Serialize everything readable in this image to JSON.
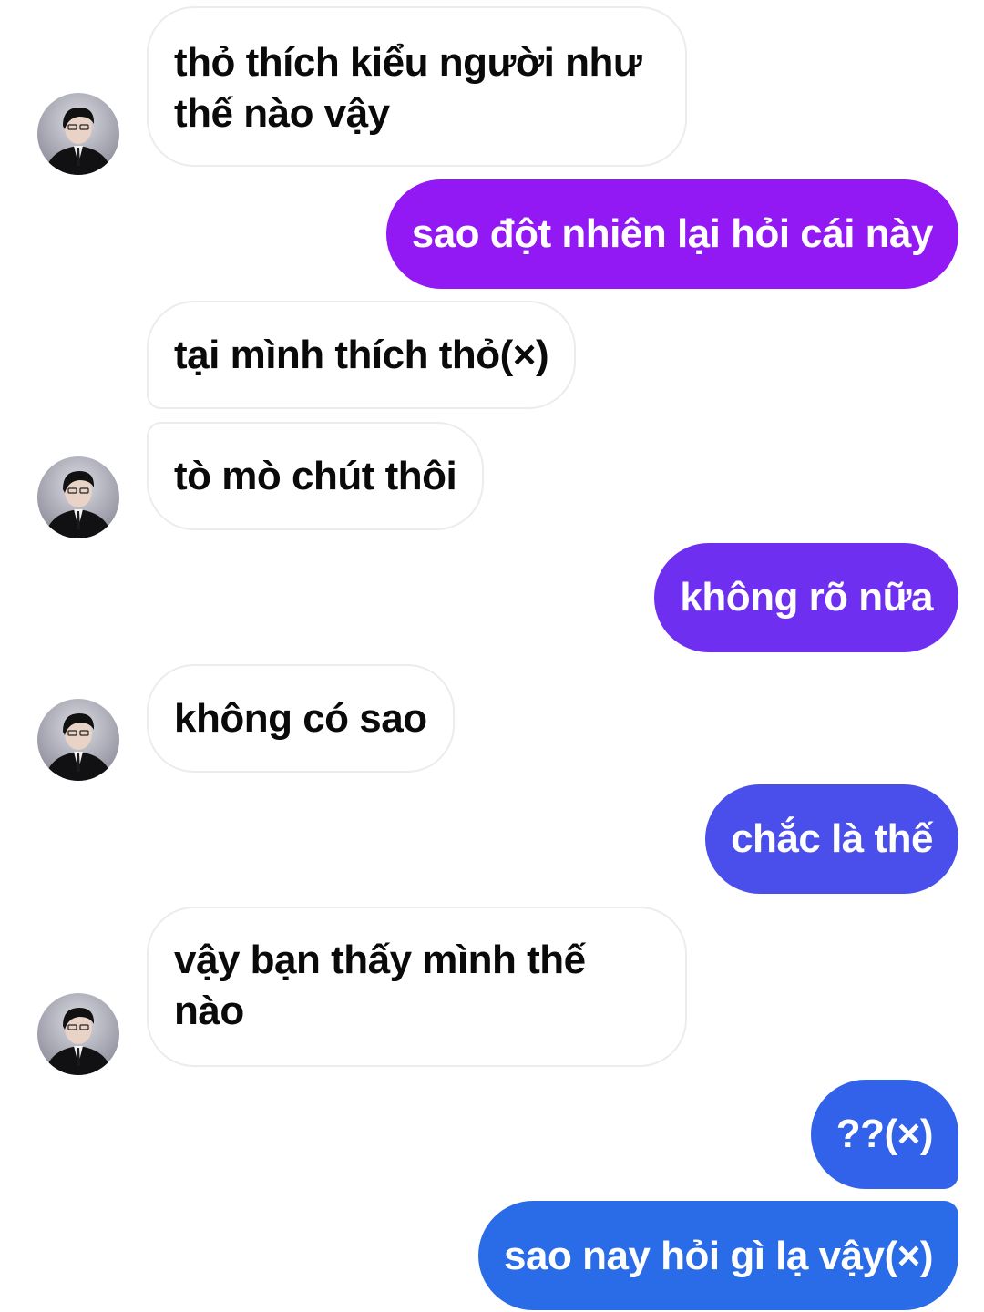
{
  "colors": {
    "incoming_bg": "#ffffff",
    "incoming_text": "#0a0a0a",
    "incoming_border": "#ececec",
    "outgoing_text": "#ffffff",
    "outgoing_gradient_top": "#9a18f5",
    "outgoing_gradient_bottom": "#2a6ce8"
  },
  "messages": [
    {
      "id": 1,
      "direction": "incoming",
      "text": "thỏ thích kiểu người như thế nào vậy",
      "avatar": "profile-photo-icon"
    },
    {
      "id": 2,
      "direction": "outgoing",
      "text": "sao đột nhiên lại hỏi cái này"
    },
    {
      "id": 3,
      "direction": "incoming",
      "text": "tại mình thích thỏ(×)"
    },
    {
      "id": 4,
      "direction": "incoming",
      "text": "tò mò chút thôi",
      "avatar": "profile-photo-icon"
    },
    {
      "id": 5,
      "direction": "outgoing",
      "text": "không rõ nữa"
    },
    {
      "id": 6,
      "direction": "incoming",
      "text": "không có sao",
      "avatar": "profile-photo-icon"
    },
    {
      "id": 7,
      "direction": "outgoing",
      "text": "chắc là thế"
    },
    {
      "id": 8,
      "direction": "incoming",
      "text": "vậy bạn thấy mình thế nào",
      "avatar": "profile-photo-icon"
    },
    {
      "id": 9,
      "direction": "outgoing",
      "text": "??(×)"
    },
    {
      "id": 10,
      "direction": "outgoing",
      "text": "sao nay hỏi gì lạ vậy(×)"
    }
  ]
}
